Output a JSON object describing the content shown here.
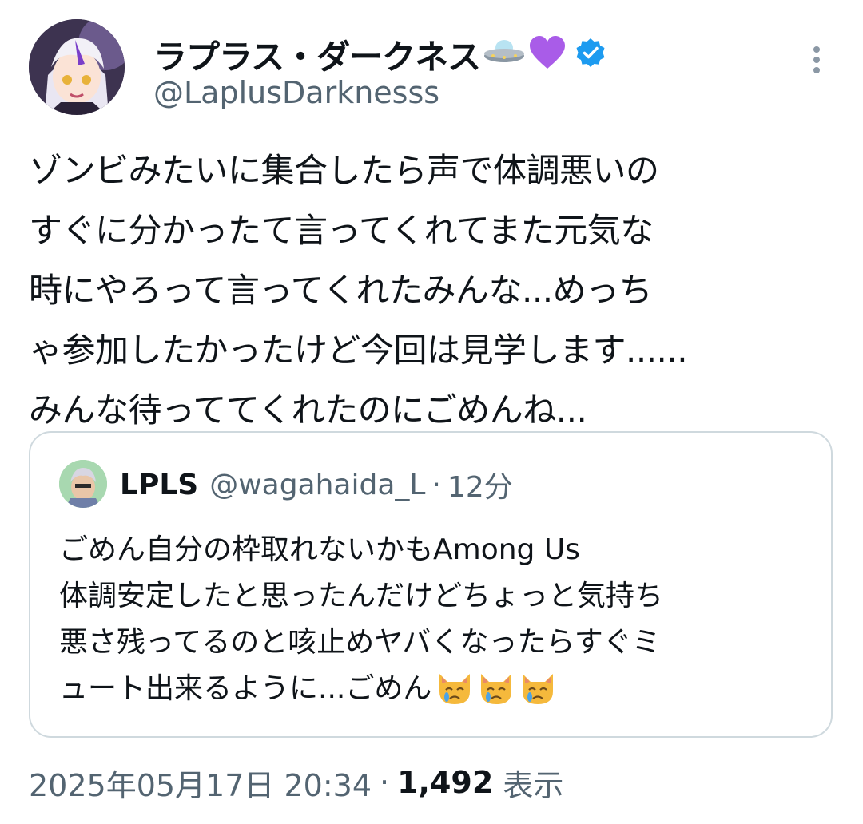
{
  "author": {
    "display_name": "ラプラス・ダークネス",
    "name_emojis": [
      "ufo-emoji",
      "purple-heart-emoji"
    ],
    "verified": true,
    "handle": "@LaplusDarknesss"
  },
  "tweet": {
    "text": "ゾンビみたいに集合したら声で体調悪いの\nすぐに分かったて言ってくれてまた元気な\n時にやろって言ってくれたみんな...めっち\nゃ参加したかったけど今回は見学します......\nみんな待っててくれたのにごめんね..."
  },
  "quote": {
    "name": "LPLS",
    "handle": "@wagahaida_L",
    "separator": "·",
    "time": "12分",
    "text": "ごめん自分の枠取れないかもAmong Us\n体調安定したと思ったんだけどちょっと気持ち\n悪さ残ってるのと咳止めヤバくなったらすぐミ",
    "last_line": "ュート出来るように...ごめん",
    "trailing_emojis": [
      "crying-cat-emoji",
      "crying-cat-emoji",
      "crying-cat-emoji"
    ]
  },
  "footer": {
    "timestamp": "2025年05月17日 20:34",
    "separator": "·",
    "views_count": "1,492",
    "views_label": "表示"
  },
  "colors": {
    "text": "#0f1419",
    "secondary": "#536471",
    "border": "#cfd9de",
    "verified_blue": "#1d9bf0",
    "heart_purple": "#a95ce8"
  }
}
